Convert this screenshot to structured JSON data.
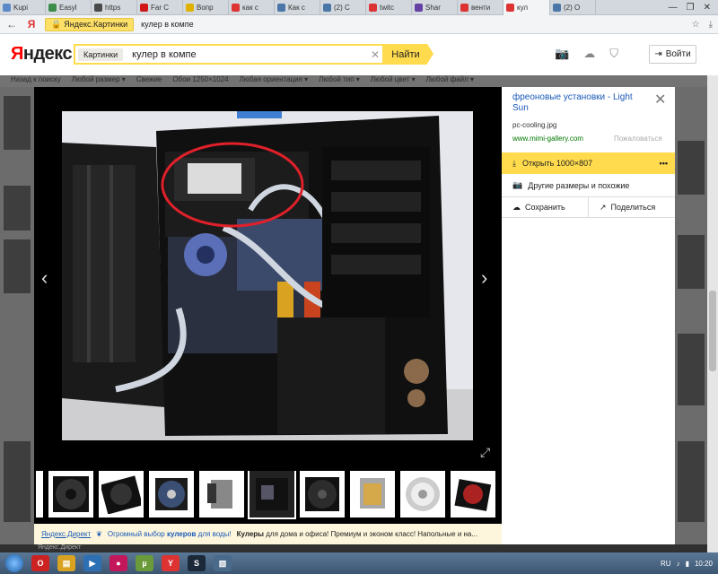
{
  "tabs": [
    {
      "label": "Kupi",
      "color": "#5b88c6"
    },
    {
      "label": "Easyl",
      "color": "#3c8d4c"
    },
    {
      "label": "https",
      "color": "#4a4a4a"
    },
    {
      "label": "Far C",
      "color": "#d01818"
    },
    {
      "label": "Вопр",
      "color": "#e0b100"
    },
    {
      "label": "как с",
      "color": "#d33"
    },
    {
      "label": "Как с",
      "color": "#4a76a8"
    },
    {
      "label": "(2) С",
      "color": "#4a76a8"
    },
    {
      "label": "twitc",
      "color": "#d33"
    },
    {
      "label": "Shar",
      "color": "#6441a4"
    },
    {
      "label": "венти",
      "color": "#d33"
    },
    {
      "label": "кул",
      "color": "#d33",
      "active": true
    },
    {
      "label": "(2) О",
      "color": "#4a76a8"
    }
  ],
  "window": {
    "minimize": "—",
    "maximize": "❐",
    "close": "✕"
  },
  "address": {
    "site": "Яндекс.Картинки",
    "query": "кулер в компе"
  },
  "header": {
    "logo_first": "Я",
    "logo_rest": "ндекс",
    "search_chip": "Картинки",
    "search_value": "кулер в компе",
    "find_button": "Найти",
    "login_button": "Войти"
  },
  "filters": [
    "Назад к поиску",
    "Любой размер ▾",
    "Свежие",
    "Обои 1250×1024",
    "Любая ориентация ▾",
    "Любой тип ▾",
    "Любой цвет ▾",
    "Любой файл ▾"
  ],
  "viewer": {
    "direct_label": "Яндекс.Директ",
    "ad_prefix": "Огромный выбор ",
    "ad_bold": "кулеров",
    "ad_suffix": " для воды!",
    "desc_bold": "Кулеры",
    "desc_text": " для дома и офиса! Премиум и эконом класс! Напольные и на...",
    "footer": "Яндекс.Директ"
  },
  "panel": {
    "title": "фреоновые установки - Light Sun",
    "file": "pc-cooling.jpg",
    "domain": "www.mimi-gallery.com",
    "complain": "Пожаловаться",
    "open_button": "Открыть 1000×807",
    "more": "•••",
    "other_sizes": "Другие размеры и похожие",
    "save": "Сохранить",
    "share": "Поделиться"
  },
  "taskbar": {
    "lang": "RU",
    "time": "10:20"
  },
  "colors": {
    "yandex_yellow": "#ffdb4d",
    "link_blue": "#1a5ab7",
    "domain_green": "#007700"
  }
}
